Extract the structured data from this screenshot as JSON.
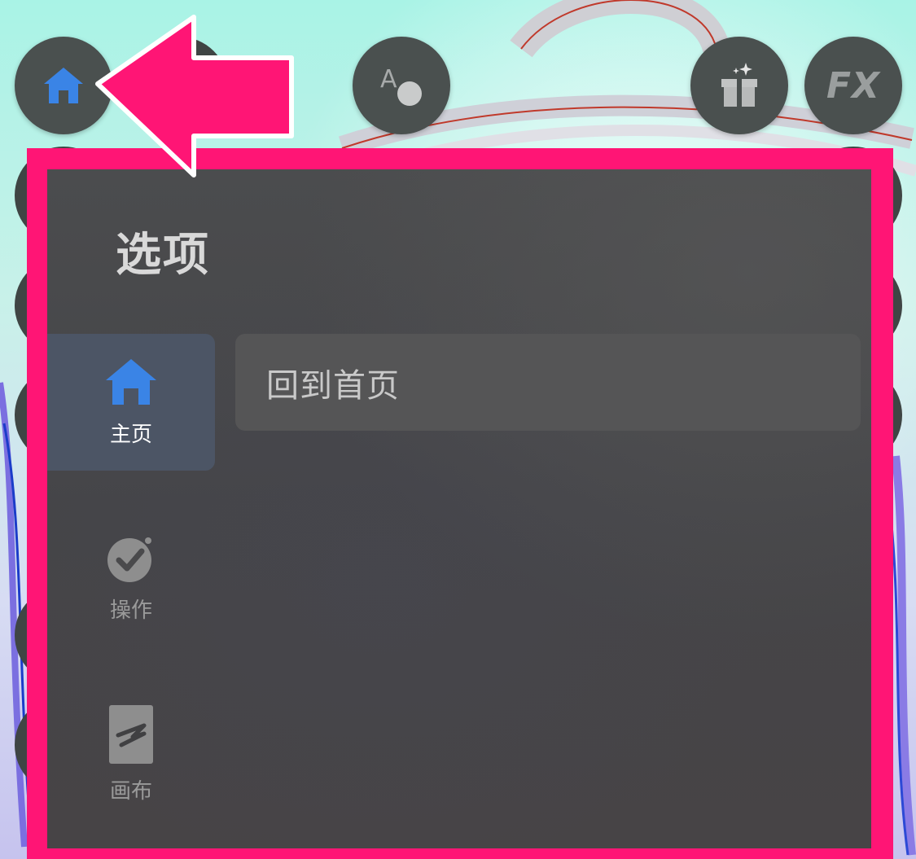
{
  "panel": {
    "title": "选项",
    "sidebar": {
      "items": [
        {
          "label": "主页",
          "icon": "home-icon",
          "active": true
        },
        {
          "label": "操作",
          "icon": "check-circle-icon",
          "active": false
        },
        {
          "label": "画布",
          "icon": "canvas-icon",
          "active": false
        }
      ]
    },
    "content": {
      "items": [
        {
          "label": "回到首页"
        }
      ]
    }
  },
  "toolbar": {
    "fx_label": "FX",
    "buttons": [
      "home-icon",
      "text-shape-icon",
      "gift-icon",
      "fx-icon"
    ]
  },
  "colors": {
    "highlight": "#ff1575",
    "accent_blue": "#3a84e6",
    "panel_bg": "#48484a",
    "active_item_bg": "#4c5565"
  }
}
